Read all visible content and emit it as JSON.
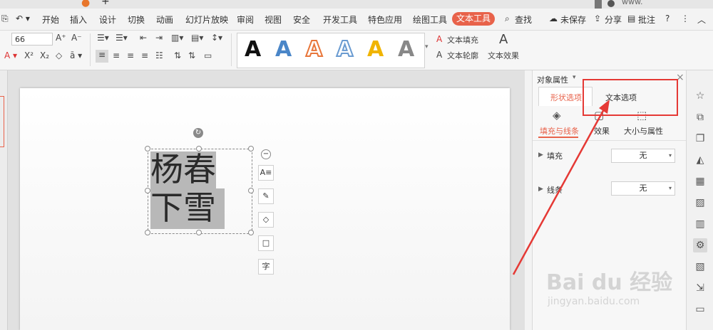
{
  "menu": {
    "items": [
      "开始",
      "插入",
      "设计",
      "切换",
      "动画",
      "幻灯片放映",
      "审阅",
      "视图",
      "安全",
      "开发工具",
      "特色应用",
      "绘图工具"
    ],
    "active_tab": "文本工具",
    "search": "查找",
    "unsaved": "未保存",
    "share": "分享",
    "review": "批注",
    "help": "?",
    "more": "⋮",
    "collapse": "︿"
  },
  "ribbon": {
    "font_size": "66",
    "increase": "A⁺",
    "decrease": "A⁻",
    "text_fill": "文本填充",
    "text_outline": "文本轮廓",
    "text_effect": "文本效果",
    "gallery_letter": "A",
    "gallery_colors": [
      "#111111",
      "#4a86c8",
      "#e8763a",
      "#6a9bd1",
      "#f0b400",
      "#7a7a7a"
    ]
  },
  "slide": {
    "line1": "杨春",
    "line2": "下雪"
  },
  "float_tools": [
    "A≡",
    "✎",
    "◇",
    "□",
    "字"
  ],
  "panel": {
    "title": "对象属性",
    "tab_shape": "形状选项",
    "tab_text": "文本选项",
    "sub_fill_line": "填充与线条",
    "sub_effect": "效果",
    "sub_size": "大小与属性",
    "fill_label": "填充",
    "fill_value": "无",
    "line_label": "线条",
    "line_value": "无",
    "close": "×"
  },
  "watermark": {
    "brand": "Bai du 经验",
    "url": "jingyan.baidu.com"
  },
  "colors": {
    "accent": "#e8624a",
    "highlight_red": "#e53935",
    "selection_gray": "#b8b8b8"
  }
}
